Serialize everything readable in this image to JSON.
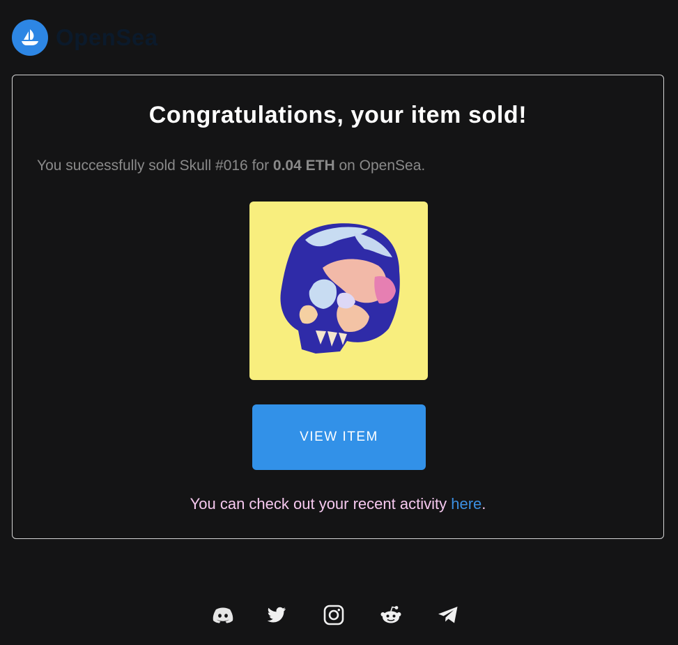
{
  "brand": {
    "name": "OpenSea",
    "logo_color": "#2d86e4"
  },
  "card": {
    "heading": "Congratulations, your item sold!",
    "message": {
      "prefix": "You successfully sold Skull #016 for ",
      "price": "0.04 ETH",
      "suffix": " on OpenSea."
    },
    "item_image": {
      "background": "#f8ee7e",
      "icon": "skull-artwork"
    },
    "view_button_label": "VIEW ITEM",
    "activity": {
      "prefix": "You can check out your recent activity ",
      "link_label": "here",
      "suffix": "."
    }
  },
  "footer": {
    "socials": [
      {
        "name": "discord-icon"
      },
      {
        "name": "twitter-icon"
      },
      {
        "name": "instagram-icon"
      },
      {
        "name": "reddit-icon"
      },
      {
        "name": "telegram-icon"
      }
    ]
  },
  "colors": {
    "background": "#141415",
    "accent": "#3291e8",
    "link": "#3b8fe2",
    "activity_text": "#f6c9ef"
  }
}
